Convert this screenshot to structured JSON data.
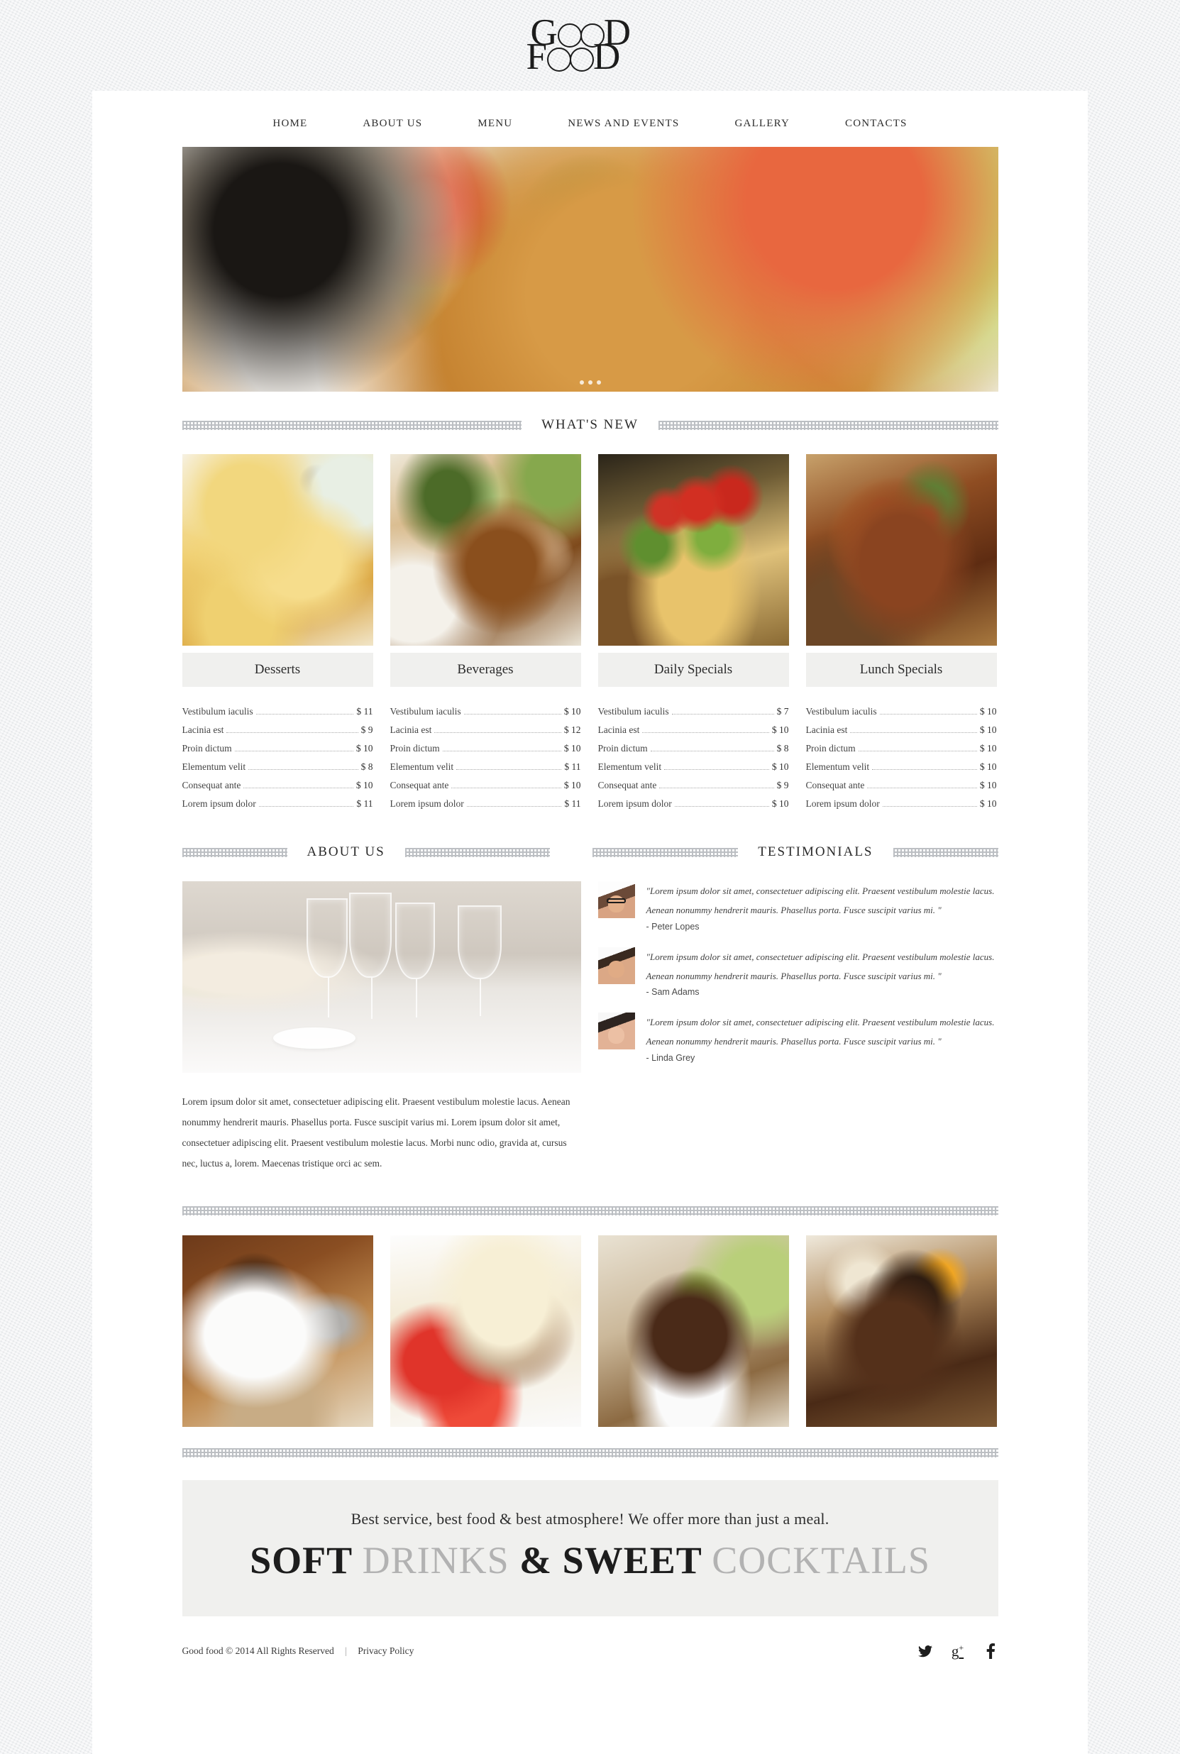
{
  "brand": {
    "logo_line1_prefix": "G",
    "logo_line1_suffix": "D",
    "logo_line2_prefix": "F",
    "logo_line2_suffix": "D",
    "logo_text": "GOOD FOOD"
  },
  "nav": {
    "items": [
      {
        "label": "HOME"
      },
      {
        "label": "ABOUT US"
      },
      {
        "label": "MENU"
      },
      {
        "label": "NEWS AND EVENTS"
      },
      {
        "label": "GALLERY"
      },
      {
        "label": "CONTACTS"
      }
    ]
  },
  "hero": {
    "alt": "pasta-penne-with-basil-and-parmesan",
    "slides": 3,
    "active_slide": 1
  },
  "whats_new": {
    "title": "WHAT'S NEW",
    "cards": [
      {
        "title": "Desserts",
        "photo": "poached-pears-dessert",
        "items": [
          {
            "name": "Vestibulum iaculis",
            "price": "$ 11"
          },
          {
            "name": "Lacinia est",
            "price": "$ 9"
          },
          {
            "name": "Proin dictum",
            "price": "$ 10"
          },
          {
            "name": "Elementum velit",
            "price": "$ 8"
          },
          {
            "name": "Consequat ante",
            "price": "$ 10"
          },
          {
            "name": "Lorem ipsum dolor",
            "price": "$ 11"
          }
        ]
      },
      {
        "title": "Beverages",
        "photo": "seafood-roll-with-sauce",
        "items": [
          {
            "name": "Vestibulum iaculis",
            "price": "$ 10"
          },
          {
            "name": "Lacinia est",
            "price": "$ 12"
          },
          {
            "name": "Proin dictum",
            "price": "$ 10"
          },
          {
            "name": "Elementum velit",
            "price": "$ 11"
          },
          {
            "name": "Consequat ante",
            "price": "$ 10"
          },
          {
            "name": "Lorem ipsum dolor",
            "price": "$ 11"
          }
        ]
      },
      {
        "title": "Daily Specials",
        "photo": "flatbread-pizza-with-tomatoes",
        "items": [
          {
            "name": "Vestibulum iaculis",
            "price": "$ 7"
          },
          {
            "name": "Lacinia est",
            "price": "$ 10"
          },
          {
            "name": "Proin dictum",
            "price": "$ 8"
          },
          {
            "name": "Elementum velit",
            "price": "$ 10"
          },
          {
            "name": "Consequat ante",
            "price": "$ 9"
          },
          {
            "name": "Lorem ipsum dolor",
            "price": "$ 10"
          }
        ]
      },
      {
        "title": "Lunch Specials",
        "photo": "grilled-steak-with-rosemary",
        "items": [
          {
            "name": "Vestibulum iaculis",
            "price": "$ 10"
          },
          {
            "name": "Lacinia est",
            "price": "$ 10"
          },
          {
            "name": "Proin dictum",
            "price": "$ 10"
          },
          {
            "name": "Elementum velit",
            "price": "$ 10"
          },
          {
            "name": "Consequat ante",
            "price": "$ 10"
          },
          {
            "name": "Lorem ipsum dolor",
            "price": "$ 10"
          }
        ]
      }
    ]
  },
  "about": {
    "title": "ABOUT US",
    "photo": "table-setting-with-wine-glasses",
    "text": "Lorem ipsum dolor sit amet, consectetuer adipiscing elit. Praesent vestibulum molestie lacus. Aenean nonummy hendrerit mauris. Phasellus porta. Fusce suscipit varius mi. Lorem ipsum dolor sit amet, consectetuer adipiscing elit. Praesent vestibulum molestie lacus. Morbi nunc odio, gravida at, cursus nec, luctus a, lorem. Maecenas tristique orci ac sem."
  },
  "testimonials": {
    "title": "TESTIMONIALS",
    "items": [
      {
        "quote": "\"Lorem ipsum dolor sit amet, consectetuer adipiscing elit. Praesent vestibulum molestie lacus. Aenean nonummy hendrerit mauris. Phasellus porta. Fusce suscipit varius mi. \"",
        "author": "- Peter Lopes",
        "avatar": "man-with-glasses-avatar"
      },
      {
        "quote": "\"Lorem ipsum dolor sit amet, consectetuer adipiscing elit. Praesent vestibulum molestie lacus. Aenean nonummy hendrerit mauris. Phasellus porta. Fusce suscipit varius mi. \"",
        "author": "- Sam Adams",
        "avatar": "man-avatar"
      },
      {
        "quote": "\"Lorem ipsum dolor sit amet, consectetuer adipiscing elit. Praesent vestibulum molestie lacus. Aenean nonummy hendrerit mauris. Phasellus porta. Fusce suscipit varius mi. \"",
        "author": "- Linda Grey",
        "avatar": "woman-avatar"
      }
    ]
  },
  "gallery": {
    "items": [
      {
        "alt": "coffee-cup-with-heart-and-spoon"
      },
      {
        "alt": "cheesecake-slice-with-strawberries"
      },
      {
        "alt": "chocolate-souffle-with-pear"
      },
      {
        "alt": "chocolate-cake-with-physalis"
      }
    ]
  },
  "promo": {
    "subline": "Best service, best food & best atmosphere! We offer more than just a meal.",
    "head_part1": "SOFT",
    "head_part2": "DRINKS",
    "head_part3": "& SWEET",
    "head_part4": "COCKTAILS"
  },
  "footer": {
    "copyright": "Good food © 2014 All Rights Reserved",
    "separator": "|",
    "privacy": "Privacy Policy",
    "socials": [
      {
        "name": "twitter",
        "glyph": "🐦"
      },
      {
        "name": "google-plus",
        "glyph": "g⁺"
      },
      {
        "name": "facebook",
        "glyph": "f"
      }
    ]
  },
  "colors": {
    "page_bg": "#eceef0",
    "sheet_bg": "#ffffff",
    "band_bg": "#f0f0ee",
    "text_dark": "#1d1d1d",
    "text_light": "#b2b2b2"
  }
}
